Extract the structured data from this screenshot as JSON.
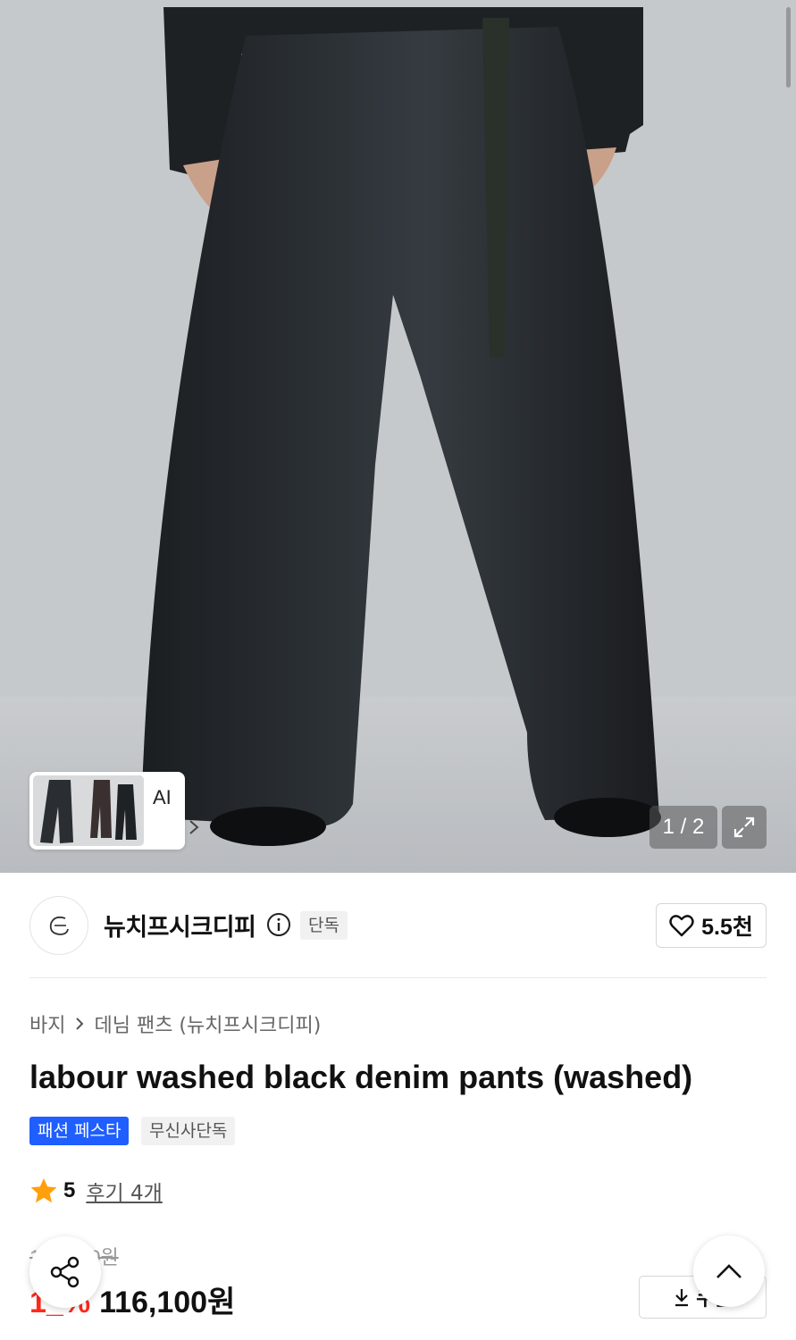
{
  "gallery": {
    "ai_label": "AI",
    "counter": "1 / 2"
  },
  "brand": {
    "name": "뉴치프시크디피",
    "exclusive_badge": "단독",
    "likes": "5.5천"
  },
  "breadcrumb": {
    "category": "바지",
    "subcategory": "데님 팬츠 (뉴치프시크디피)"
  },
  "product": {
    "title": "labour washed black denim pants (washed)",
    "tags": [
      "패션 페스타",
      "무신사단독"
    ],
    "rating": "5",
    "reviews": "후기 4개"
  },
  "price": {
    "original": "1__,_00원",
    "discount_rate": "1_%",
    "sale": "116,100원",
    "coupon_label": "쿠폰"
  },
  "colors": {
    "accent_blue": "#1f5eff",
    "discount_red": "#ff2a1a",
    "star": "#ff9f0a"
  },
  "icons": [
    "info-icon",
    "heart-icon",
    "chevron-right-icon",
    "expand-icon",
    "star-icon",
    "download-icon",
    "share-icon",
    "chevron-up-icon"
  ]
}
